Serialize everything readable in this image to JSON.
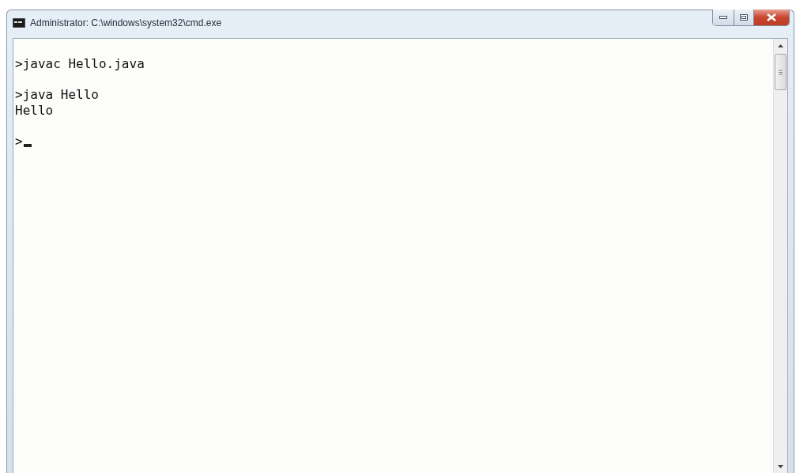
{
  "window": {
    "title": "Administrator: C:\\windows\\system32\\cmd.exe"
  },
  "console": {
    "entries": [
      {
        "input": ">javac Hello.java",
        "cursor": false
      },
      {
        "input": ">java Hello",
        "output": [
          "Hello"
        ],
        "cursor": false
      },
      {
        "input": ">",
        "cursor": true
      }
    ]
  }
}
